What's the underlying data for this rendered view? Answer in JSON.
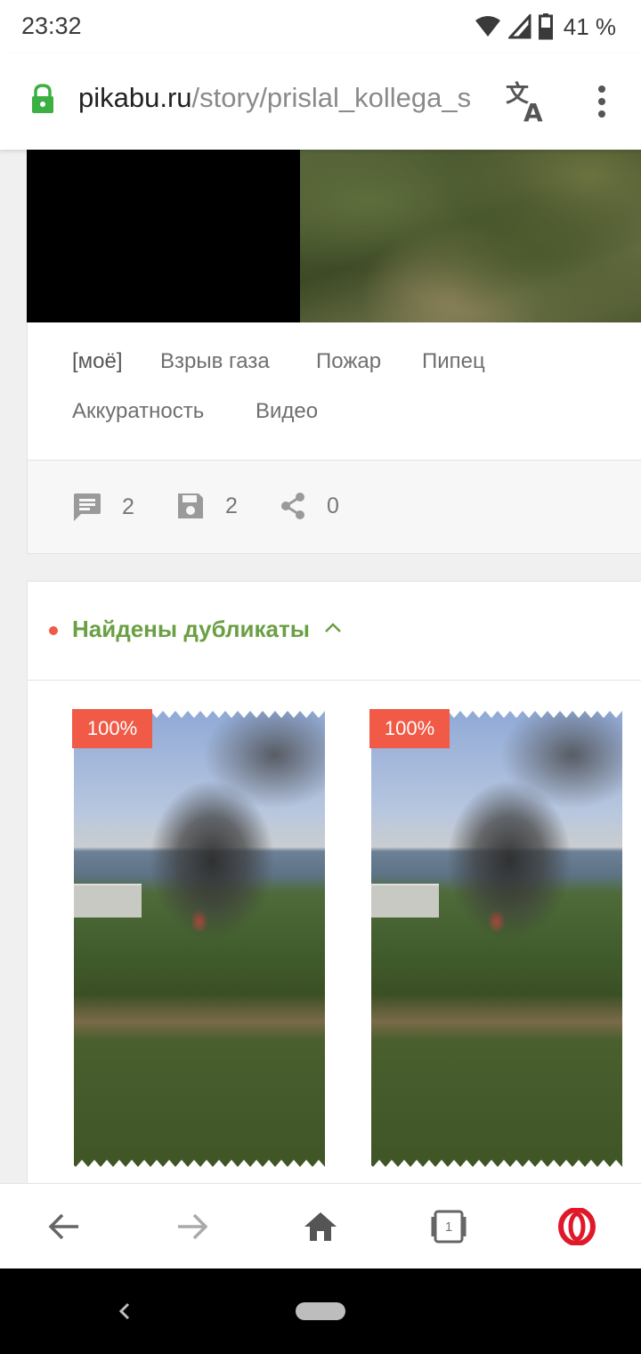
{
  "status_bar": {
    "time": "23:32",
    "battery": "41 %"
  },
  "url_bar": {
    "domain": "pikabu.ru",
    "path": "/story/prislal_kollega_s"
  },
  "post": {
    "tags": [
      "[моё]",
      "Взрыв газа",
      "Пожар",
      "Пипец",
      "Аккуратность",
      "Видео"
    ],
    "comments_count": "2",
    "saves_count": "2",
    "shares_count": "0"
  },
  "duplicates": {
    "title": "Найдены дубликаты",
    "items": [
      {
        "match": "100%"
      },
      {
        "match": "100%"
      }
    ]
  },
  "bottom_nav": {
    "tabs_count": "1"
  },
  "colors": {
    "accent_green": "#6aa043",
    "badge_red": "#f05a46",
    "opera_red": "#e0192a"
  }
}
